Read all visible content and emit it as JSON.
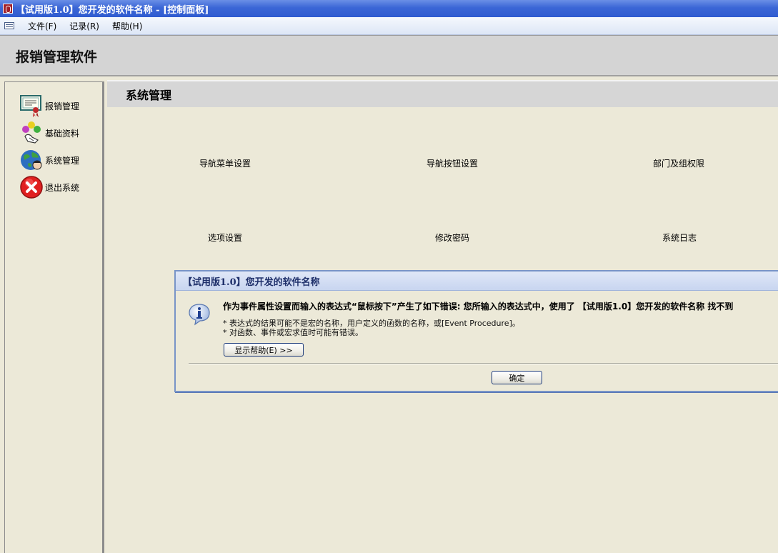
{
  "window": {
    "title": "【试用版1.0】您开发的软件名称 - [控制面板]"
  },
  "menubar": {
    "items": [
      {
        "label": "文件(F)"
      },
      {
        "label": "记录(R)"
      },
      {
        "label": "帮助(H)"
      }
    ]
  },
  "header": {
    "title": "报销管理软件"
  },
  "sidebar": {
    "items": [
      {
        "label": "报销管理",
        "icon": "certificate-icon"
      },
      {
        "label": "基础资料",
        "icon": "molecule-icon"
      },
      {
        "label": "系统管理",
        "icon": "globe-icon"
      },
      {
        "label": "退出系统",
        "icon": "close-icon"
      }
    ]
  },
  "main": {
    "title": "系统管理",
    "buttons": [
      {
        "label": "导航菜单设置"
      },
      {
        "label": "导航按钮设置"
      },
      {
        "label": "部门及组权限"
      },
      {
        "label": "选项设置"
      },
      {
        "label": "修改密码"
      },
      {
        "label": "系统日志"
      }
    ]
  },
  "dialog": {
    "title": "【试用版1.0】您开发的软件名称",
    "message": "作为事件属性设置而输入的表达式“鼠标按下”产生了如下错误: 您所输入的表达式中，使用了 【试用版1.0】您开发的软件名称 找不到",
    "details": [
      "* 表达式的结果可能不是宏的名称，用户定义的函数的名称，或[Event Procedure]。",
      "* 对函数、事件或宏求值时可能有错误。"
    ],
    "help_button": "显示帮助(E) >>",
    "ok_button": "确定"
  },
  "colors": {
    "titlebar": "#2f5bd0",
    "background": "#ece9d8",
    "header": "#d4d4d4"
  }
}
